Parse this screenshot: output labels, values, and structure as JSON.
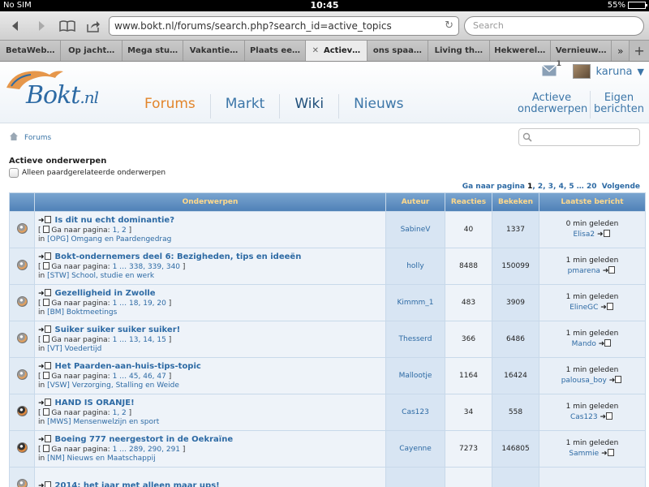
{
  "statusbar": {
    "carrier": "No SIM",
    "time": "10:45",
    "battery": "55%"
  },
  "browser": {
    "url": "www.bokt.nl/forums/search.php?search_id=active_topics",
    "search_placeholder": "Search",
    "tabs": [
      {
        "label": "BetaWeb…",
        "active": false
      },
      {
        "label": "Op jacht…",
        "active": false
      },
      {
        "label": "Mega stu…",
        "active": false
      },
      {
        "label": "Vakantie…",
        "active": false
      },
      {
        "label": "Plaats ee…",
        "active": false
      },
      {
        "label": "Actiev…",
        "active": true
      },
      {
        "label": "ons spaa…",
        "active": false
      },
      {
        "label": "Living th…",
        "active": false
      },
      {
        "label": "Hekwerel…",
        "active": false
      },
      {
        "label": "Vernieuw…",
        "active": false
      }
    ],
    "more_tabs": "»",
    "add_tab": "+"
  },
  "site": {
    "logo_text": "Bokt",
    "logo_suffix": ".nl",
    "nav": [
      {
        "label": "Forums",
        "active": true
      },
      {
        "label": "Markt",
        "active": false
      },
      {
        "label": "Wiki",
        "active": false
      },
      {
        "label": "Nieuws",
        "active": false
      }
    ],
    "mail_count": "1",
    "username": "karuna",
    "header_links": [
      {
        "label": "Actieve onderwerpen"
      },
      {
        "label": "Eigen berichten"
      }
    ],
    "breadcrumb": "Forums"
  },
  "page": {
    "title": "Actieve onderwerpen",
    "filter_label": "Alleen paardgerelateerde onderwerpen",
    "pager": {
      "prefix": "Ga naar pagina",
      "current": "1",
      "pages": [
        "2",
        "3",
        "4",
        "5"
      ],
      "ellipsis": "…",
      "last": "20",
      "next": "Volgende"
    },
    "columns": {
      "topics": "Onderwerpen",
      "author": "Auteur",
      "replies": "Reacties",
      "views": "Bekeken",
      "last_post": "Laatste bericht"
    },
    "goto_label": "Ga naar pagina:",
    "in_label": "in",
    "rows": [
      {
        "title": "Is dit nu echt dominantie?",
        "pages": "1, 2",
        "forum": "[OPG] Omgang en Paardengedrag",
        "author": "SabineV",
        "replies": "40",
        "views": "1337",
        "last_time": "0 min geleden",
        "last_by": "Elisa2",
        "hot": false
      },
      {
        "title": "Bokt-ondernemers deel 6: Bezigheden, tips en ideeën",
        "pages": "1 … 338, 339, 340",
        "forum": "[STW] School, studie en werk",
        "author": "holly",
        "replies": "8488",
        "views": "150099",
        "last_time": "1 min geleden",
        "last_by": "pmarena",
        "hot": false
      },
      {
        "title": "Gezelligheid in Zwolle",
        "pages": "1 … 18, 19, 20",
        "forum": "[BM] Boktmeetings",
        "author": "Kimmm_1",
        "replies": "483",
        "views": "3909",
        "last_time": "1 min geleden",
        "last_by": "ElineGC",
        "hot": false
      },
      {
        "title": "Suiker suiker suiker suiker!",
        "pages": "1 … 13, 14, 15",
        "forum": "[VT] Voedertijd",
        "author": "Thesserd",
        "replies": "366",
        "views": "6486",
        "last_time": "1 min geleden",
        "last_by": "Mando",
        "hot": false
      },
      {
        "title": "Het Paarden-aan-huis-tips-topic",
        "pages": "1 … 45, 46, 47",
        "forum": "[VSW] Verzorging, Stalling en Weide",
        "author": "Mallootje",
        "replies": "1164",
        "views": "16424",
        "last_time": "1 min geleden",
        "last_by": "palousa_boy",
        "hot": false
      },
      {
        "title": "HAND IS ORANJE!",
        "pages": "1, 2",
        "forum": "[MWS] Mensenwelzijn en sport",
        "author": "Cas123",
        "replies": "34",
        "views": "558",
        "last_time": "1 min geleden",
        "last_by": "Cas123",
        "hot": true
      },
      {
        "title": "Boeing 777 neergestort in de Oekraïne",
        "pages": "1 … 289, 290, 291",
        "forum": "[NM] Nieuws en Maatschappij",
        "author": "Cayenne",
        "replies": "7273",
        "views": "146805",
        "last_time": "1 min geleden",
        "last_by": "Sammie",
        "hot": true
      },
      {
        "title": "2014: het jaar met alleen maar ups!",
        "pages": "",
        "forum": "",
        "author": "",
        "replies": "",
        "views": "",
        "last_time": "",
        "last_by": "",
        "hot": false
      }
    ]
  },
  "colors": {
    "brand_blue": "#2d6aa4",
    "active_nav": "#e2852b",
    "header_text": "#ffd98b"
  }
}
